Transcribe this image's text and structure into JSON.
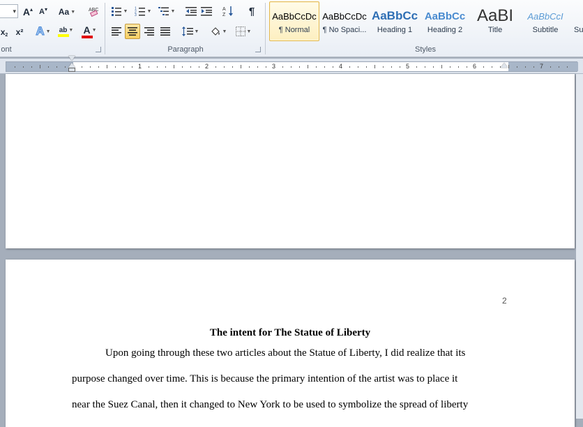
{
  "ribbon": {
    "groups": {
      "font_label": "ont",
      "paragraph_label": "Paragraph",
      "styles_label": "Styles"
    },
    "font": {
      "grow_font_label": "A",
      "shrink_font_label": "A",
      "change_case_label": "Aa",
      "subscript_label": "x",
      "superscript_label": "x²",
      "text_effects_label": "A",
      "highlight_label": "ab",
      "font_color_label": "A",
      "highlight_color": "#ffff00",
      "font_color": "#e00000"
    },
    "paragraph": {
      "pilcrow_label": "¶",
      "active_alignment": "center"
    },
    "styles": [
      {
        "preview": "AaBbCcDc",
        "name": "¶ Normal",
        "selected": true
      },
      {
        "preview": "AaBbCcDc",
        "name": "¶ No Spaci...",
        "selected": false
      },
      {
        "preview": "AaBbCc",
        "name": "Heading 1",
        "selected": false
      },
      {
        "preview": "AaBbCc",
        "name": "Heading 2",
        "selected": false
      },
      {
        "preview": "AaBI",
        "name": "Title",
        "selected": false
      },
      {
        "preview": "AaBbCcI",
        "name": "Subtitle",
        "selected": false
      },
      {
        "preview": "",
        "name": "Su",
        "selected": false
      }
    ]
  },
  "ruler": {
    "numbers": [
      "1",
      "2",
      "3",
      "4",
      "5",
      "6",
      "7"
    ]
  },
  "document": {
    "page_number": "2",
    "title": "The intent for The Statue of Liberty",
    "lines": [
      "Upon going through these two articles about the Statue of Liberty, I did realize that its",
      "purpose changed over time.  This is because the primary intention of the artist was to place it",
      "near the Suez Canal, then it changed to New York to be used to symbolize the spread of liberty"
    ]
  }
}
